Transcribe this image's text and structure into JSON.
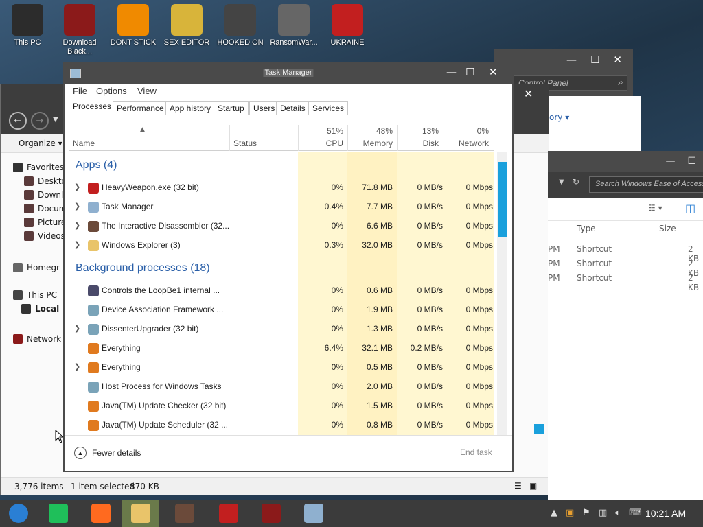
{
  "desktop_icons": [
    {
      "label": "This PC",
      "icon": "monitor-icon",
      "color": "#2c2c2c"
    },
    {
      "label": "Download Black...",
      "icon": "download-app-icon",
      "color": "#8b1a1a"
    },
    {
      "label": "DONT STICK",
      "icon": "vlc-cone-icon",
      "color": "#f08a00"
    },
    {
      "label": "SEX EDITOR",
      "icon": "hex-editor-icon",
      "color": "#d8b43a"
    },
    {
      "label": "HOOKED ON",
      "icon": "hook-icon",
      "color": "#444444"
    },
    {
      "label": "RansomWar...",
      "icon": "skull-icon",
      "color": "#666666"
    },
    {
      "label": "UKRAINE",
      "icon": "radiation-icon",
      "color": "#c21f1f"
    }
  ],
  "control_panel": {
    "search_placeholder": "Control Panel",
    "link": "ory ▾"
  },
  "explorer": {
    "organize": "Organize ▾",
    "tree": [
      {
        "label": "Favorites"
      },
      {
        "label": "Deskto"
      },
      {
        "label": "Downl"
      },
      {
        "label": "Docum"
      },
      {
        "label": "Picture"
      },
      {
        "label": "Videos"
      },
      {
        "label": "Homegr"
      },
      {
        "label": "This PC"
      },
      {
        "label": "Local"
      },
      {
        "label": "Network"
      }
    ],
    "status_items": "3,776 items",
    "status_selected": "1 item selected",
    "status_size": "870 KB"
  },
  "ease_window": {
    "search_placeholder": "Search Windows Ease of Access",
    "columns": {
      "type": "Type",
      "size": "Size"
    },
    "rows": [
      {
        "time": "PM",
        "type": "Shortcut",
        "size": "2 KB"
      },
      {
        "time": "PM",
        "type": "Shortcut",
        "size": "2 KB"
      },
      {
        "time": "PM",
        "type": "Shortcut",
        "size": "2 KB"
      }
    ]
  },
  "task_manager": {
    "title": "Task Manager",
    "menu": [
      "File",
      "Options",
      "View"
    ],
    "tabs": [
      "Processes",
      "Performance",
      "App history",
      "Startup",
      "Users",
      "Details",
      "Services"
    ],
    "active_tab": "Processes",
    "columns": {
      "name": "Name",
      "status": "Status",
      "cpu_pct": "51%",
      "cpu": "CPU",
      "mem_pct": "48%",
      "mem": "Memory",
      "disk_pct": "13%",
      "disk": "Disk",
      "net_pct": "0%",
      "net": "Network"
    },
    "groups": {
      "apps": "Apps (4)",
      "background": "Background processes (18)"
    },
    "apps": [
      {
        "name": "HeavyWeapon.exe (32 bit)",
        "cpu": "0%",
        "mem": "71.8 MB",
        "disk": "0 MB/s",
        "net": "0 Mbps",
        "expand": true,
        "icon": "radiation-icon",
        "color": "#c21f1f"
      },
      {
        "name": "Task Manager",
        "cpu": "0.4%",
        "mem": "7.7 MB",
        "disk": "0 MB/s",
        "net": "0 Mbps",
        "expand": true,
        "icon": "taskmgr-icon",
        "color": "#8fb0cf"
      },
      {
        "name": "The Interactive Disassembler (32...",
        "cpu": "0%",
        "mem": "6.6 MB",
        "disk": "0 MB/s",
        "net": "0 Mbps",
        "expand": true,
        "icon": "portrait-icon",
        "color": "#6b4a3a"
      },
      {
        "name": "Windows Explorer (3)",
        "cpu": "0.3%",
        "mem": "32.0 MB",
        "disk": "0 MB/s",
        "net": "0 Mbps",
        "expand": true,
        "icon": "folder-icon",
        "color": "#e9c46a"
      }
    ],
    "background": [
      {
        "name": "Controls the LoopBe1 internal ...",
        "cpu": "0%",
        "mem": "0.6 MB",
        "disk": "0 MB/s",
        "net": "0 Mbps",
        "expand": false,
        "icon": "loopbe-icon",
        "color": "#4a4a6a"
      },
      {
        "name": "Device Association Framework ...",
        "cpu": "0%",
        "mem": "1.9 MB",
        "disk": "0 MB/s",
        "net": "0 Mbps",
        "expand": false,
        "icon": "service-icon",
        "color": "#7aa3b8"
      },
      {
        "name": "DissenterUpgrader (32 bit)",
        "cpu": "0%",
        "mem": "1.3 MB",
        "disk": "0 MB/s",
        "net": "0 Mbps",
        "expand": true,
        "icon": "service-icon",
        "color": "#7aa3b8"
      },
      {
        "name": "Everything",
        "cpu": "6.4%",
        "mem": "32.1 MB",
        "disk": "0.2 MB/s",
        "net": "0 Mbps",
        "expand": false,
        "icon": "magnifier-icon",
        "color": "#e07a1f"
      },
      {
        "name": "Everything",
        "cpu": "0%",
        "mem": "0.5 MB",
        "disk": "0 MB/s",
        "net": "0 Mbps",
        "expand": true,
        "icon": "magnifier-icon",
        "color": "#e07a1f"
      },
      {
        "name": "Host Process for Windows Tasks",
        "cpu": "0%",
        "mem": "2.0 MB",
        "disk": "0 MB/s",
        "net": "0 Mbps",
        "expand": false,
        "icon": "service-icon",
        "color": "#7aa3b8"
      },
      {
        "name": "Java(TM) Update Checker (32 bit)",
        "cpu": "0%",
        "mem": "1.5 MB",
        "disk": "0 MB/s",
        "net": "0 Mbps",
        "expand": false,
        "icon": "java-icon",
        "color": "#e07a1f"
      },
      {
        "name": "Java(TM) Update Scheduler (32 ...",
        "cpu": "0%",
        "mem": "0.8 MB",
        "disk": "0 MB/s",
        "net": "0 Mbps",
        "expand": false,
        "icon": "java-icon",
        "color": "#e07a1f"
      }
    ],
    "fewer_details": "Fewer details",
    "end_task": "End task"
  },
  "taskbar": {
    "apps": [
      {
        "icon": "start-orb-icon",
        "color": "#2a7fd4"
      },
      {
        "icon": "notes-app-icon",
        "color": "#1fbf5a"
      },
      {
        "icon": "firefox-icon",
        "color": "#ff6a1f"
      },
      {
        "icon": "file-explorer-icon",
        "color": "#e9c46a"
      },
      {
        "icon": "portrait-app-icon",
        "color": "#6b4a3a"
      },
      {
        "icon": "radiation-app-icon",
        "color": "#c21f1f"
      },
      {
        "icon": "monitor-app-icon",
        "color": "#8b1a1a"
      },
      {
        "icon": "taskmgr-app-icon",
        "color": "#8fb0cf"
      }
    ],
    "clock": "10:21 AM"
  }
}
